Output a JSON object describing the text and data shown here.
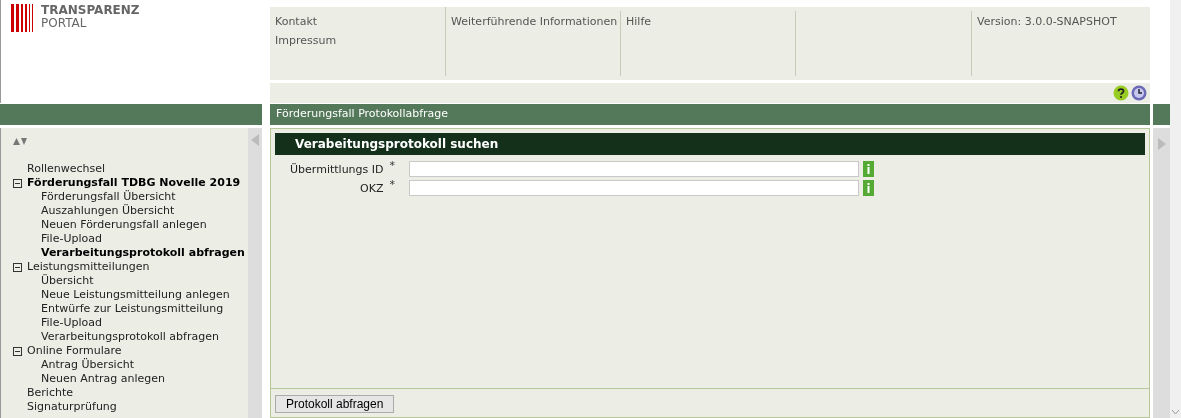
{
  "logo": {
    "title": "TRANSPARENZ",
    "subtitle": "PORTAL"
  },
  "top_nav": [
    {
      "links": [
        "Kontakt",
        "Impressum"
      ]
    },
    {
      "links": [
        "Weiterführende Informationen"
      ]
    },
    {
      "links": [
        "Hilfe"
      ]
    }
  ],
  "version": "Version: 3.0.0-SNAPSHOT",
  "page_title": "Förderungsfall Protokollabfrage",
  "sidebar": {
    "items": [
      {
        "label": "Rollenwechsel",
        "selected": false
      },
      {
        "label": "Förderungsfall TDBG Novelle 2019",
        "selected": true,
        "expanded": true,
        "children": [
          {
            "label": "Förderungsfall Übersicht",
            "selected": false
          },
          {
            "label": "Auszahlungen Übersicht",
            "selected": false
          },
          {
            "label": "Neuen Förderungsfall anlegen",
            "selected": false
          },
          {
            "label": "File-Upload",
            "selected": false
          },
          {
            "label": "Verarbeitungsprotokoll abfragen",
            "selected": true
          }
        ]
      },
      {
        "label": "Leistungsmitteilungen",
        "selected": false,
        "expanded": true,
        "children": [
          {
            "label": "Übersicht",
            "selected": false
          },
          {
            "label": "Neue Leistungsmitteilung anlegen",
            "selected": false
          },
          {
            "label": "Entwürfe zur Leistungsmitteilung",
            "selected": false
          },
          {
            "label": "File-Upload",
            "selected": false
          },
          {
            "label": "Verarbeitungsprotokoll abfragen",
            "selected": false
          }
        ]
      },
      {
        "label": "Online Formulare",
        "selected": false,
        "expanded": true,
        "children": [
          {
            "label": "Antrag Übersicht",
            "selected": false
          },
          {
            "label": "Neuen Antrag anlegen",
            "selected": false
          }
        ]
      },
      {
        "label": "Berichte",
        "selected": false
      },
      {
        "label": "Signaturprüfung",
        "selected": false
      }
    ]
  },
  "form": {
    "title": "Verabeitungsprotokoll suchen",
    "fields": [
      {
        "label": "Übermittlungs ID",
        "required_mark": "*"
      },
      {
        "label": "OKZ",
        "required_mark": "*"
      }
    ],
    "submit": "Protokoll abfragen"
  }
}
